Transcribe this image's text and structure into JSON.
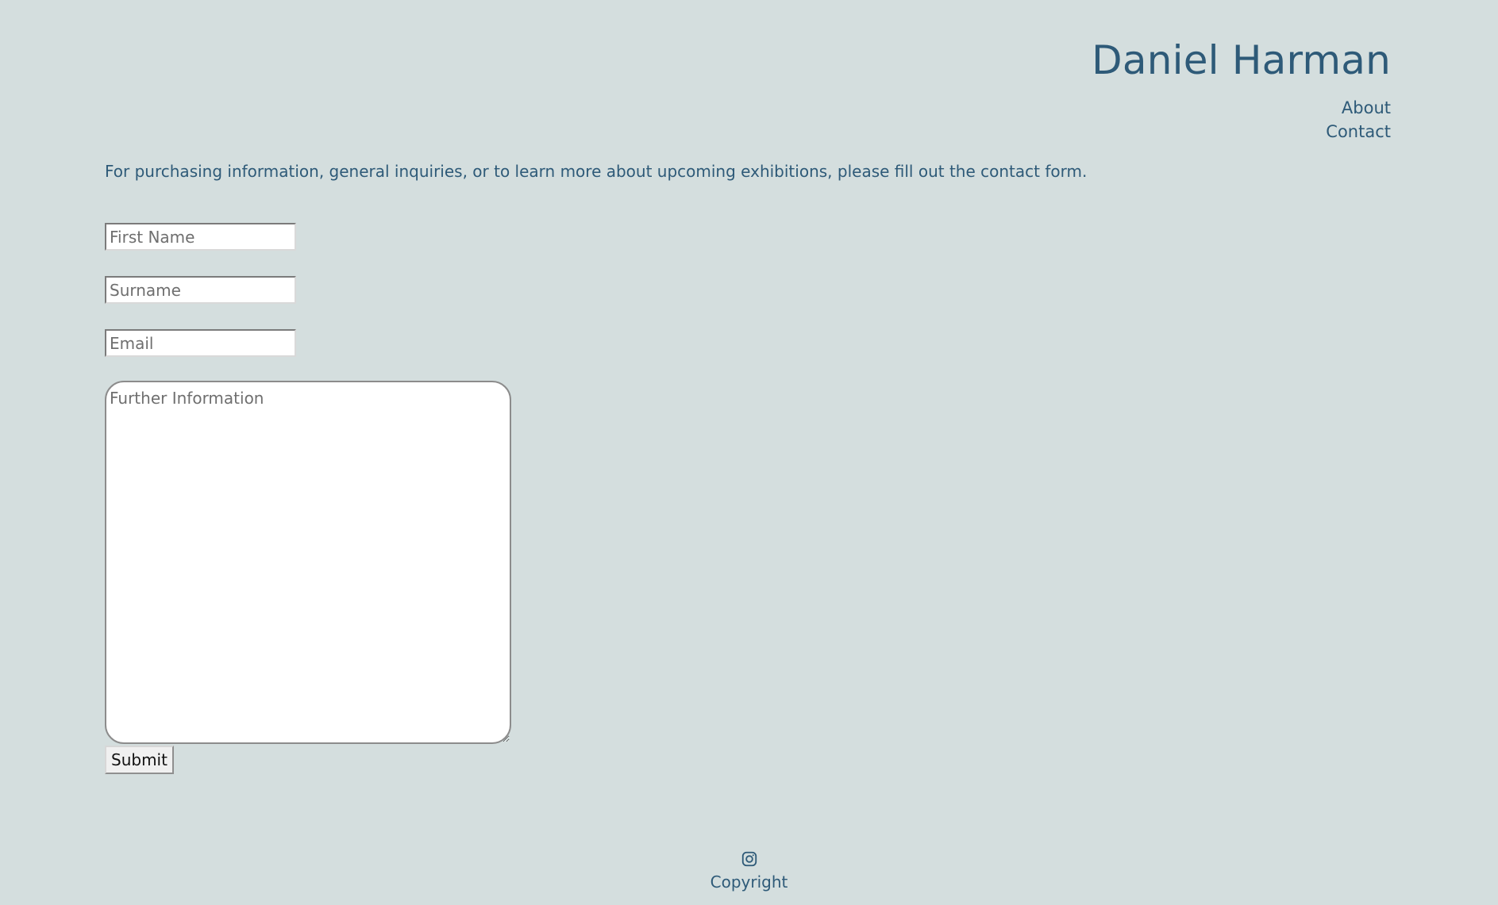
{
  "header": {
    "title": "Daniel Harman",
    "nav": [
      {
        "label": "About"
      },
      {
        "label": "Contact"
      }
    ]
  },
  "main": {
    "intro": "For purchasing information, general inquiries, or to learn more about upcoming exhibitions, please fill out the contact form.",
    "form": {
      "first_name_placeholder": "First Name",
      "first_name_value": "",
      "surname_placeholder": "Surname",
      "surname_value": "",
      "email_placeholder": "Email",
      "email_value": "",
      "further_info_placeholder": "Further Information",
      "further_info_value": "",
      "submit_label": "Submit"
    }
  },
  "footer": {
    "social_icon": "instagram-icon",
    "copyright": "Copyright"
  },
  "colors": {
    "background": "#d4dede",
    "text": "#2e5a78",
    "field_background": "#ffffff"
  }
}
